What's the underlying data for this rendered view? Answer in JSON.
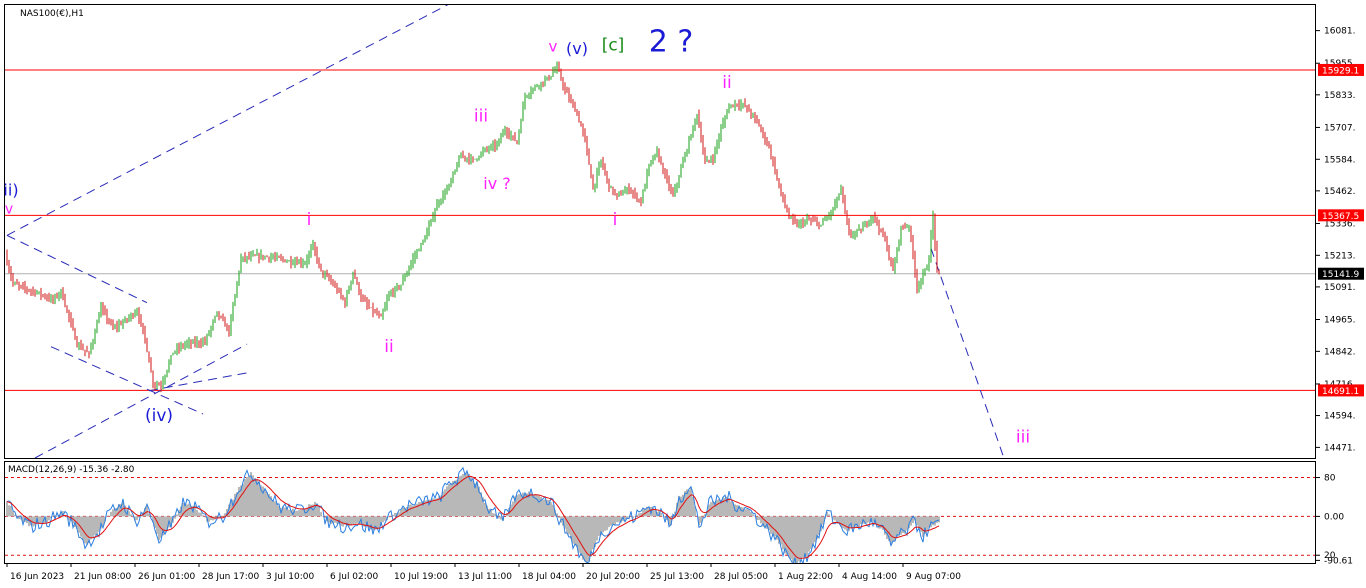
{
  "window": {
    "title": "NAS100(€),H1"
  },
  "colors": {
    "bull": "#16a016",
    "bear": "#d01515",
    "level_line": "#ff0000",
    "current_line": "#b0b0b0",
    "wave_magenta": "#ff22ff",
    "wave_blue": "#1b1bd6",
    "wave_green": "#178a17",
    "trendline": "#2a2ab8",
    "macd_hist": "#b8b8b8",
    "macd_main": "#2b7fe0",
    "macd_signal": "#e01010",
    "macd_levels": "#e01010"
  },
  "chart_data": [
    {
      "type": "candlestick",
      "symbol_label": "NAS100(€),H1",
      "timeframe": "H1",
      "ylim": [
        14430,
        16180
      ],
      "yticks": [
        "16081.",
        "15955.",
        "15833.",
        "15707.",
        "15584.",
        "15462.",
        "15336.",
        "15213.",
        "15091.",
        "14965.",
        "14842.",
        "14716.",
        "14594.",
        "14471."
      ],
      "ytick_values": [
        16081,
        15955,
        15833,
        15707,
        15584,
        15462,
        15336,
        15213,
        15091,
        14965,
        14842,
        14716,
        14594,
        14471
      ],
      "horizontal_levels": [
        15929.1,
        15367.5,
        14691.1
      ],
      "price_tags": [
        {
          "label": "15929.1",
          "value": 15929.1,
          "style": "red"
        },
        {
          "label": "15367.5",
          "value": 15367.5,
          "style": "red"
        },
        {
          "label": "15141.9",
          "value": 15141.9,
          "style": "black"
        },
        {
          "label": "14691.1",
          "value": 14691.1,
          "style": "red"
        }
      ],
      "current_price": 15141.9,
      "xtick_labels": [
        "16 Jun 2023",
        "21 Jun 08:00",
        "26 Jun 01:00",
        "28 Jun 17:00",
        "3 Jul 10:00",
        "6 Jul 02:00",
        "10 Jul 19:00",
        "13 Jul 11:00",
        "18 Jul 04:00",
        "20 Jul 20:00",
        "25 Jul 13:00",
        "28 Jul 05:00",
        "1 Aug 22:00",
        "4 Aug 14:00",
        "9 Aug 07:00"
      ],
      "xtick_bars": [
        0,
        32,
        64,
        96,
        128,
        160,
        192,
        224,
        256,
        288,
        320,
        352,
        384,
        416,
        448
      ],
      "total_bars": 467,
      "price_path": [
        [
          0,
          15215
        ],
        [
          4,
          15105
        ],
        [
          8,
          15090
        ],
        [
          16,
          15070
        ],
        [
          24,
          15040
        ],
        [
          28,
          15075
        ],
        [
          36,
          14870
        ],
        [
          42,
          14830
        ],
        [
          48,
          15010
        ],
        [
          54,
          14930
        ],
        [
          60,
          14960
        ],
        [
          66,
          15000
        ],
        [
          70,
          14890
        ],
        [
          74,
          14720
        ],
        [
          78,
          14710
        ],
        [
          84,
          14840
        ],
        [
          90,
          14870
        ],
        [
          100,
          14880
        ],
        [
          106,
          14990
        ],
        [
          112,
          14920
        ],
        [
          118,
          15200
        ],
        [
          126,
          15210
        ],
        [
          134,
          15205
        ],
        [
          142,
          15190
        ],
        [
          150,
          15185
        ],
        [
          154,
          15250
        ],
        [
          158,
          15150
        ],
        [
          162,
          15120
        ],
        [
          166,
          15080
        ],
        [
          170,
          15030
        ],
        [
          174,
          15150
        ],
        [
          178,
          15050
        ],
        [
          182,
          15010
        ],
        [
          188,
          14970
        ],
        [
          192,
          15060
        ],
        [
          198,
          15100
        ],
        [
          204,
          15200
        ],
        [
          210,
          15280
        ],
        [
          216,
          15410
        ],
        [
          222,
          15480
        ],
        [
          228,
          15600
        ],
        [
          234,
          15580
        ],
        [
          240,
          15620
        ],
        [
          246,
          15640
        ],
        [
          250,
          15700
        ],
        [
          256,
          15650
        ],
        [
          260,
          15830
        ],
        [
          266,
          15870
        ],
        [
          272,
          15900
        ],
        [
          276,
          15940
        ],
        [
          280,
          15850
        ],
        [
          286,
          15760
        ],
        [
          290,
          15660
        ],
        [
          294,
          15470
        ],
        [
          298,
          15580
        ],
        [
          302,
          15480
        ],
        [
          306,
          15440
        ],
        [
          312,
          15470
        ],
        [
          318,
          15420
        ],
        [
          322,
          15560
        ],
        [
          326,
          15610
        ],
        [
          330,
          15520
        ],
        [
          334,
          15440
        ],
        [
          340,
          15600
        ],
        [
          346,
          15760
        ],
        [
          350,
          15570
        ],
        [
          354,
          15590
        ],
        [
          358,
          15700
        ],
        [
          362,
          15790
        ],
        [
          366,
          15800
        ],
        [
          370,
          15790
        ],
        [
          376,
          15730
        ],
        [
          382,
          15630
        ],
        [
          388,
          15450
        ],
        [
          392,
          15360
        ],
        [
          396,
          15330
        ],
        [
          402,
          15350
        ],
        [
          408,
          15330
        ],
        [
          414,
          15390
        ],
        [
          418,
          15470
        ],
        [
          422,
          15290
        ],
        [
          428,
          15310
        ],
        [
          434,
          15370
        ],
        [
          440,
          15270
        ],
        [
          444,
          15150
        ],
        [
          448,
          15320
        ],
        [
          452,
          15330
        ],
        [
          456,
          15090
        ],
        [
          460,
          15150
        ],
        [
          462,
          15200
        ],
        [
          464,
          15370
        ],
        [
          466,
          15141.9
        ]
      ],
      "annotations": [
        {
          "text": "v",
          "color": "magenta",
          "bar": 273,
          "price": 16000,
          "size": 15
        },
        {
          "text": "(v)",
          "color": "blue",
          "bar": 285,
          "price": 15990,
          "size": 16
        },
        {
          "text": "[c]",
          "color": "green",
          "bar": 303,
          "price": 16005,
          "size": 17
        },
        {
          "text": "2 ?",
          "color": "blue",
          "bar": 332,
          "price": 16000,
          "size": 30
        },
        {
          "text": "ii",
          "color": "magenta",
          "bar": 360,
          "price": 15860,
          "size": 17
        },
        {
          "text": "iii",
          "color": "magenta",
          "bar": 237,
          "price": 15730,
          "size": 17
        },
        {
          "text": "iv ?",
          "color": "magenta",
          "bar": 245,
          "price": 15470,
          "size": 16
        },
        {
          "text": "i",
          "color": "magenta",
          "bar": 151,
          "price": 15330,
          "size": 17
        },
        {
          "text": "i",
          "color": "magenta",
          "bar": 304,
          "price": 15330,
          "size": 17
        },
        {
          "text": "ii",
          "color": "magenta",
          "bar": 191,
          "price": 14840,
          "size": 17
        },
        {
          "text": "ii)",
          "color": "blue",
          "bar": 2,
          "price": 15445,
          "size": 16
        },
        {
          "text": "v",
          "color": "magenta",
          "bar": 1,
          "price": 15375,
          "size": 14
        },
        {
          "text": "(iv)",
          "color": "blue",
          "bar": 76,
          "price": 14573,
          "size": 17
        },
        {
          "text": "iii",
          "color": "magenta",
          "bar": 508,
          "price": 14490,
          "size": 17
        }
      ],
      "trendlines": [
        {
          "from": [
            0,
            15290
          ],
          "to": [
            230,
            16220
          ],
          "style": "dashed"
        },
        {
          "from": [
            0,
            15290
          ],
          "to": [
            70,
            15030
          ],
          "style": "dashed"
        },
        {
          "from": [
            14,
            14430
          ],
          "to": [
            120,
            14870
          ],
          "style": "dashed"
        },
        {
          "from": [
            22,
            14860
          ],
          "to": [
            98,
            14600
          ],
          "style": "dashed"
        },
        {
          "from": [
            71,
            14690
          ],
          "to": [
            462,
            15240
          ],
          "style": "dashed",
          "visible_segment_to_bar": 120
        },
        {
          "from": [
            462,
            15240
          ],
          "to": [
            498,
            14440
          ],
          "style": "dashed"
        }
      ]
    },
    {
      "type": "macd",
      "label": "MACD(12,26,9) -15.36 -2.80",
      "params": [
        12,
        26,
        9
      ],
      "main_value": -15.36,
      "signal_value": -2.8,
      "ylim": [
        -96,
        112
      ],
      "yticks": [
        "80",
        "0.00",
        "20",
        "-90.61"
      ],
      "ytick_values": [
        80,
        0,
        -80,
        -90.61
      ],
      "levels": [
        80,
        0,
        -80
      ],
      "histogram_path": [
        [
          0,
          30
        ],
        [
          6,
          -5
        ],
        [
          12,
          -20
        ],
        [
          20,
          -10
        ],
        [
          28,
          10
        ],
        [
          34,
          -20
        ],
        [
          40,
          -60
        ],
        [
          46,
          -30
        ],
        [
          52,
          10
        ],
        [
          58,
          30
        ],
        [
          64,
          -10
        ],
        [
          70,
          20
        ],
        [
          76,
          -50
        ],
        [
          82,
          -20
        ],
        [
          88,
          30
        ],
        [
          94,
          20
        ],
        [
          100,
          -10
        ],
        [
          108,
          0
        ],
        [
          116,
          60
        ],
        [
          122,
          90
        ],
        [
          128,
          60
        ],
        [
          136,
          20
        ],
        [
          146,
          10
        ],
        [
          154,
          30
        ],
        [
          160,
          -10
        ],
        [
          168,
          -20
        ],
        [
          176,
          -15
        ],
        [
          184,
          -30
        ],
        [
          192,
          0
        ],
        [
          200,
          20
        ],
        [
          208,
          30
        ],
        [
          216,
          40
        ],
        [
          222,
          70
        ],
        [
          230,
          90
        ],
        [
          236,
          60
        ],
        [
          240,
          20
        ],
        [
          248,
          -10
        ],
        [
          254,
          40
        ],
        [
          260,
          50
        ],
        [
          266,
          40
        ],
        [
          272,
          30
        ],
        [
          278,
          -20
        ],
        [
          284,
          -60
        ],
        [
          290,
          -100
        ],
        [
          296,
          -40
        ],
        [
          302,
          -20
        ],
        [
          308,
          -10
        ],
        [
          314,
          0
        ],
        [
          320,
          20
        ],
        [
          326,
          10
        ],
        [
          332,
          -20
        ],
        [
          336,
          40
        ],
        [
          342,
          60
        ],
        [
          346,
          -20
        ],
        [
          352,
          30
        ],
        [
          360,
          40
        ],
        [
          366,
          20
        ],
        [
          372,
          10
        ],
        [
          378,
          -20
        ],
        [
          384,
          -40
        ],
        [
          390,
          -80
        ],
        [
          394,
          -100
        ],
        [
          400,
          -80
        ],
        [
          406,
          -40
        ],
        [
          410,
          10
        ],
        [
          414,
          -10
        ],
        [
          420,
          -30
        ],
        [
          426,
          -20
        ],
        [
          432,
          -10
        ],
        [
          438,
          -30
        ],
        [
          442,
          -60
        ],
        [
          446,
          -40
        ],
        [
          450,
          -30
        ],
        [
          454,
          -10
        ],
        [
          458,
          -40
        ],
        [
          462,
          -20
        ],
        [
          466,
          -15
        ]
      ]
    }
  ]
}
